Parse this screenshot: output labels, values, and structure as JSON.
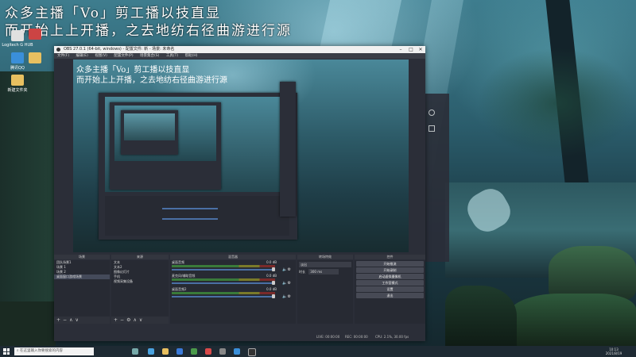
{
  "overlay": {
    "line1": "众多主播「Vo」剪工播以技直显",
    "line2": "而开始上上开播，之去地纺右径曲游进行源"
  },
  "desktop_icons": [
    {
      "label": "Logitech G HUB",
      "color": "#e0e0e0"
    },
    {
      "label": "",
      "color": "#c44"
    },
    {
      "label": "腾讯QQ",
      "color": "#3a8fd9"
    },
    {
      "label": "",
      "color": "#e8c060"
    },
    {
      "label": "新建文件夹",
      "color": "#e8c060"
    },
    {
      "label": "",
      "color": "#e8c060"
    }
  ],
  "obs": {
    "title": "OBS 27.0.1 (64-bit, windows) - 配置文件: 新 - 场景: 未命名",
    "menu": [
      "文件(F)",
      "编辑(E)",
      "视图(V)",
      "配置文件(P)",
      "场景集合(S)",
      "工具(T)",
      "帮助(H)"
    ],
    "preview_text_1": "众多主播「Vo」剪工播以技直显",
    "preview_text_2": "而开始上上开播，之去地纺右径曲游进行源",
    "panels": {
      "scenes": "场景",
      "sources": "来源",
      "mixer": "混音器",
      "transitions": "转场特效",
      "controls": "控件"
    },
    "scenes": [
      "团队场景1",
      "场景 1",
      "场景 2",
      "桌面窗口游戏场景"
    ],
    "sources": [
      "文本",
      "文本2",
      "图像幻灯片",
      "手机",
      "视频采集设备"
    ],
    "mixer": [
      {
        "name": "桌面音频",
        "db": "0.0 dB"
      },
      {
        "name": "麦克风/辅助音频",
        "db": "0.0 dB"
      },
      {
        "name": "桌面音频2",
        "db": "0.0 dB"
      }
    ],
    "transitions": {
      "type": "淡出",
      "duration_label": "时长",
      "duration": "300 ms"
    },
    "controls": [
      "开始推流",
      "开始录制",
      "启动虚拟摄像机",
      "工作室模式",
      "设置",
      "退出"
    ],
    "status": {
      "live": "LIVE: 00:00:00",
      "rec": "REC: 00:00:00",
      "cpu": "CPU: 2.1%, 30.00 fps"
    }
  },
  "taskbar": {
    "search_placeholder": "在这里输入你要搜索的内容",
    "time": "10:13",
    "date": "2021/8/19"
  },
  "icons": {
    "start": "windows-start-icon",
    "search": "search-icon",
    "close": "close-icon",
    "minimize": "minimize-icon",
    "maximize": "maximize-icon",
    "add": "plus-icon",
    "remove": "minus-icon",
    "settings": "gear-icon",
    "up": "arrow-up-icon",
    "down": "arrow-down-icon",
    "speaker": "speaker-icon"
  },
  "colors": {
    "obs_bg": "#2b2e38",
    "panel": "#272a33",
    "accent_slider": "#4a6fa5",
    "selected_row": "#444a5a"
  }
}
